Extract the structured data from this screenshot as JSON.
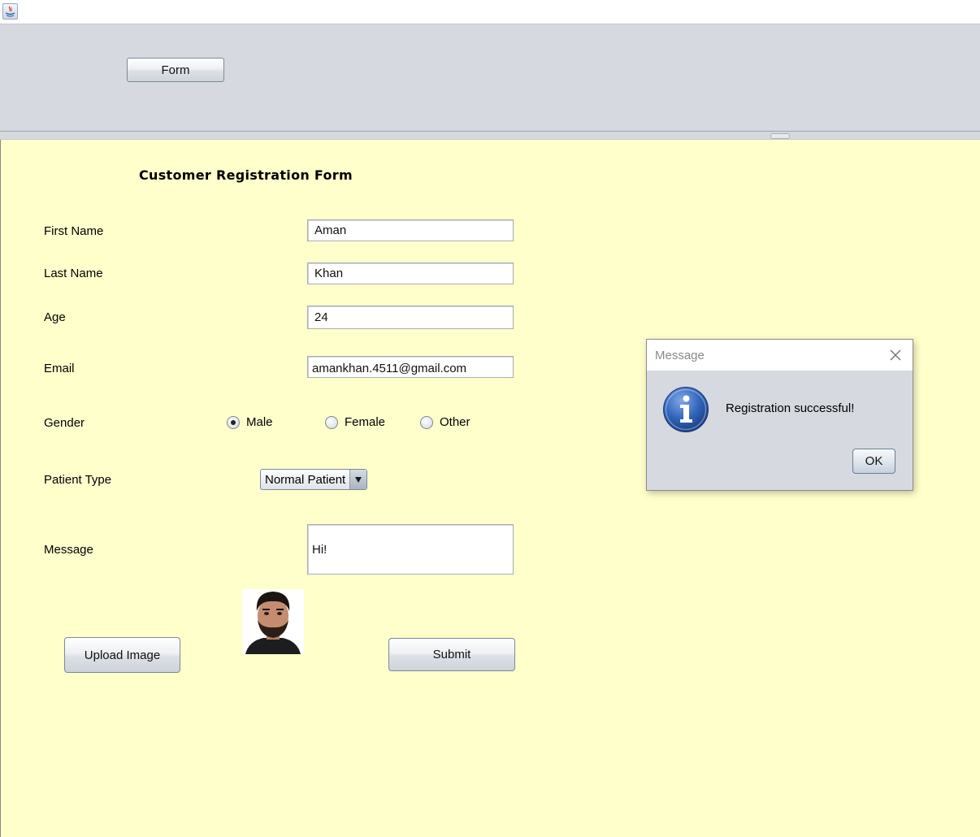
{
  "top_panel": {
    "form_button": "Form"
  },
  "form": {
    "title": "Customer Registration Form",
    "fields": {
      "first_name": {
        "label": "First Name",
        "value": "Aman"
      },
      "last_name": {
        "label": "Last Name",
        "value": "Khan"
      },
      "age": {
        "label": "Age",
        "value": "24"
      },
      "email": {
        "label": "Email",
        "value": "amankhan.4511@gmail.com"
      }
    },
    "gender": {
      "label": "Gender",
      "options": [
        "Male",
        "Female",
        "Other"
      ],
      "selected": "Male"
    },
    "patient_type": {
      "label": "Patient Type",
      "selected": "Normal Patient"
    },
    "message": {
      "label": "Message",
      "value": "Hi!"
    },
    "upload_button": "Upload Image",
    "submit_button": "Submit"
  },
  "dialog": {
    "title": "Message",
    "text": "Registration successful!",
    "ok_button": "OK",
    "icon": "info-icon"
  },
  "colors": {
    "form_background": "#ffffcc",
    "panel_background": "#d6d9df",
    "info_icon_blue": "#2f63b8"
  }
}
